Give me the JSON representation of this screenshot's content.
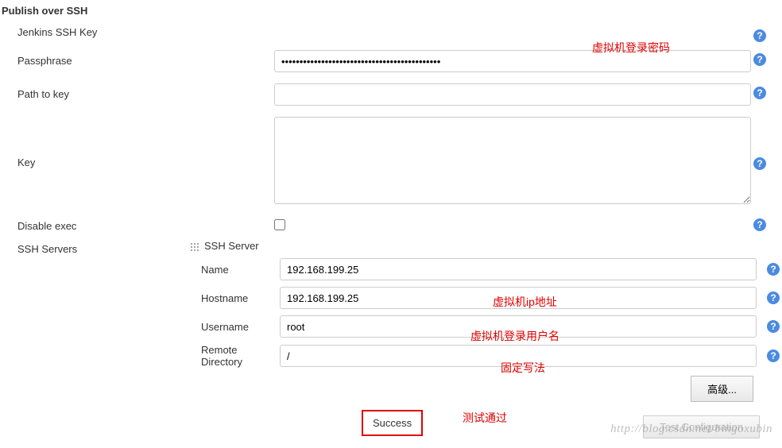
{
  "section": {
    "title": "Publish over SSH"
  },
  "jenkins_key": {
    "label": "Jenkins SSH Key"
  },
  "passphrase": {
    "label": "Passphrase",
    "value": "••••••••••••••••••••••••••••••••••••••••••••"
  },
  "path_to_key": {
    "label": "Path to key",
    "value": ""
  },
  "key": {
    "label": "Key",
    "value": ""
  },
  "disable_exec": {
    "label": "Disable exec"
  },
  "ssh_servers": {
    "label": "SSH Servers"
  },
  "server": {
    "header": "SSH Server",
    "name": {
      "label": "Name",
      "value": "192.168.199.25"
    },
    "hostname": {
      "label": "Hostname",
      "value": "192.168.199.25"
    },
    "username": {
      "label": "Username",
      "value": "root"
    },
    "remote_dir": {
      "label": "Remote Directory",
      "value": "/"
    }
  },
  "buttons": {
    "advanced": "高级...",
    "test": "Test Configuration"
  },
  "status": {
    "success": "Success"
  },
  "annotations": {
    "password": "虚拟机登录密码",
    "ip": "虚拟机ip地址",
    "user": "虚拟机登录用户名",
    "fixed": "固定写法",
    "pass": "测试通过"
  },
  "watermark": "http://blog.csdn.net/bingoxubin"
}
